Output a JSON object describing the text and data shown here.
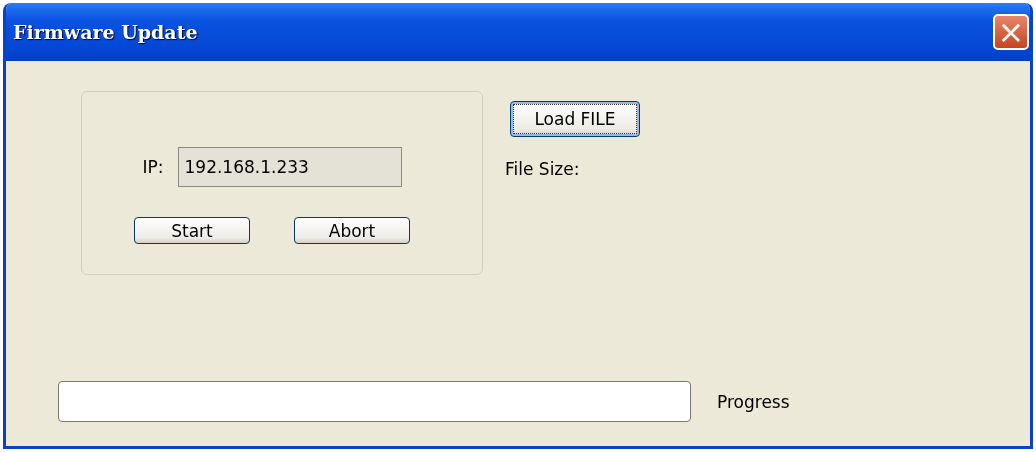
{
  "window": {
    "title": "Firmware Update",
    "close": "×"
  },
  "ip": {
    "label": "IP:",
    "value": "192.168.1.233",
    "disabled": true
  },
  "group_buttons": [
    {
      "label": "Start",
      "focused": false
    },
    {
      "label": "Abort",
      "focused": false
    }
  ],
  "load_button": {
    "label": "Load FILE",
    "focused": true
  },
  "file_size": {
    "label": "File Size:"
  },
  "progress": {
    "level": 0,
    "label": "Progress"
  }
}
